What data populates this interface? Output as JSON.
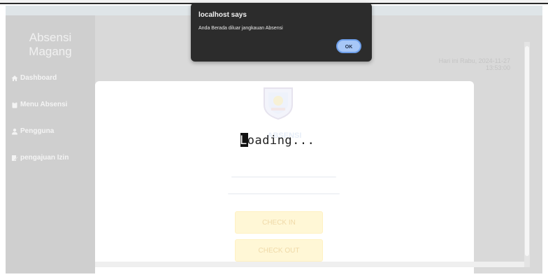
{
  "sidebar": {
    "brand": [
      "Absensi",
      "Magang"
    ],
    "items": [
      {
        "icon": "home-icon",
        "label": "Dashboard"
      },
      {
        "icon": "clipboard-icon",
        "label": "Menu Absensi"
      },
      {
        "icon": "user-icon",
        "label": "Pengguna"
      },
      {
        "icon": "edit-document-icon",
        "label": "pengajuan Izin"
      }
    ]
  },
  "header": {
    "date_line1": "Hari ini Rabu, 2024-11-27",
    "date_line2": "13:53:00"
  },
  "main": {
    "app_name": "ABSENSI",
    "check_in_label": "CHECK IN",
    "check_out_label": "CHECK OUT"
  },
  "overlay": {
    "loading_first": "L",
    "loading_rest": "oading..."
  },
  "dialog": {
    "title": "localhost says",
    "message": "Anda Berada diluar jangkauan Absensi",
    "ok_label": "OK"
  }
}
